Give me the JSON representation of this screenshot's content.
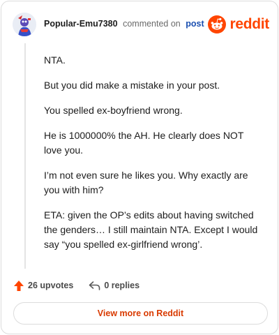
{
  "header": {
    "username": "Popular-Emu7380",
    "verb": "commented on",
    "post_link": "post",
    "brand": "reddit",
    "brand_color": "#ff4500"
  },
  "comment": {
    "paragraphs": [
      "NTA.",
      "But you did make a mistake in your post.",
      "You spelled ex-boyfriend wrong.",
      "He is 1000000% the AH. He clearly does NOT love you.",
      "I’m not even sure he likes you. Why exactly are you with him?",
      "ETA: given the OP’s edits about having switched the genders… I still maintain NTA. Except I would say “you spelled ex-girlfriend wrong’."
    ]
  },
  "actions": {
    "upvotes": "26 upvotes",
    "upvote_icon": "upvote-arrow-icon",
    "replies": "0 replies",
    "reply_icon": "reply-arrow-icon"
  },
  "footer": {
    "view_more": "View more on Reddit",
    "link_color": "#d93a00"
  }
}
